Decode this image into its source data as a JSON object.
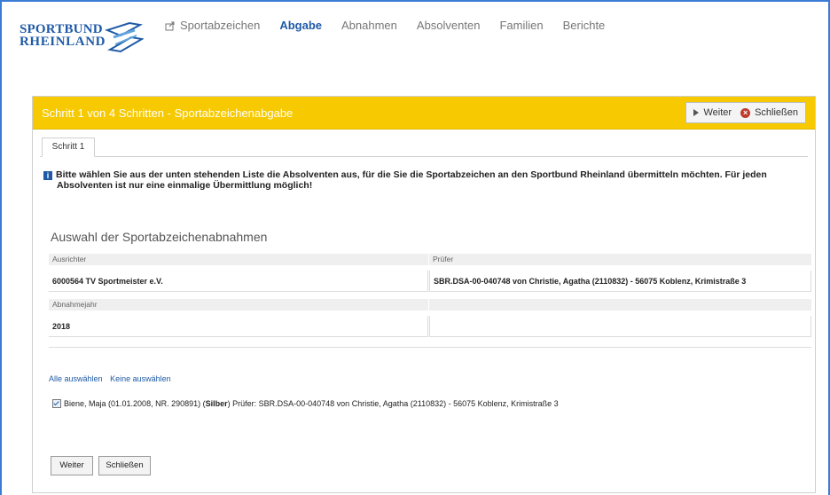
{
  "logo": {
    "line1": "SPORTBUND",
    "line2": "RHEINLAND"
  },
  "nav": [
    {
      "label": "Sportabzeichen",
      "icon": "export-icon"
    },
    {
      "label": "Abgabe"
    },
    {
      "label": "Abnahmen"
    },
    {
      "label": "Absolventen"
    },
    {
      "label": "Familien"
    },
    {
      "label": "Berichte"
    }
  ],
  "panel": {
    "title": "Schritt 1 von 4 Schritten - Sportabzeichenabgabe",
    "next_label": "Weiter",
    "close_label": "Schließen",
    "tab": "Schritt 1",
    "info_line1": "Bitte wählen Sie aus der unten stehenden Liste die Absolventen aus, für die Sie die Sportabzeichen an den Sportbund Rheinland übermitteln möchten. Für jeden",
    "info_line2": "Absolventen ist nur eine einmalige Übermittlung möglich!",
    "section_title": "Auswahl der Sportabzeichenabnahmen",
    "fields": {
      "ausrichter_label": "Ausrichter",
      "ausrichter_value": "6000564 TV Sportmeister e.V.",
      "pruefer_label": "Prüfer",
      "pruefer_value": "SBR.DSA-00-040748 von Christie, Agatha (2110832) - 56075 Koblenz, Krimistraße 3",
      "abnahmejahr_label": "Abnahmejahr",
      "abnahmejahr_value": "2018"
    },
    "select_all": "Alle auswählen",
    "select_none": "Keine auswählen",
    "candidate": {
      "checked": true,
      "before": "Biene, Maja (01.01.2008, NR. 290891) (",
      "medal": "Silber",
      "after": ") Prüfer: SBR.DSA-00-040748 von Christie, Agatha (2110832) - 56075 Koblenz, Krimistraße 3"
    },
    "footer_next": "Weiter",
    "footer_close": "Schließen"
  },
  "colors": {
    "accent": "#1f5aa6",
    "header_bar": "#f7c900",
    "close_icon": "#c0392b"
  }
}
